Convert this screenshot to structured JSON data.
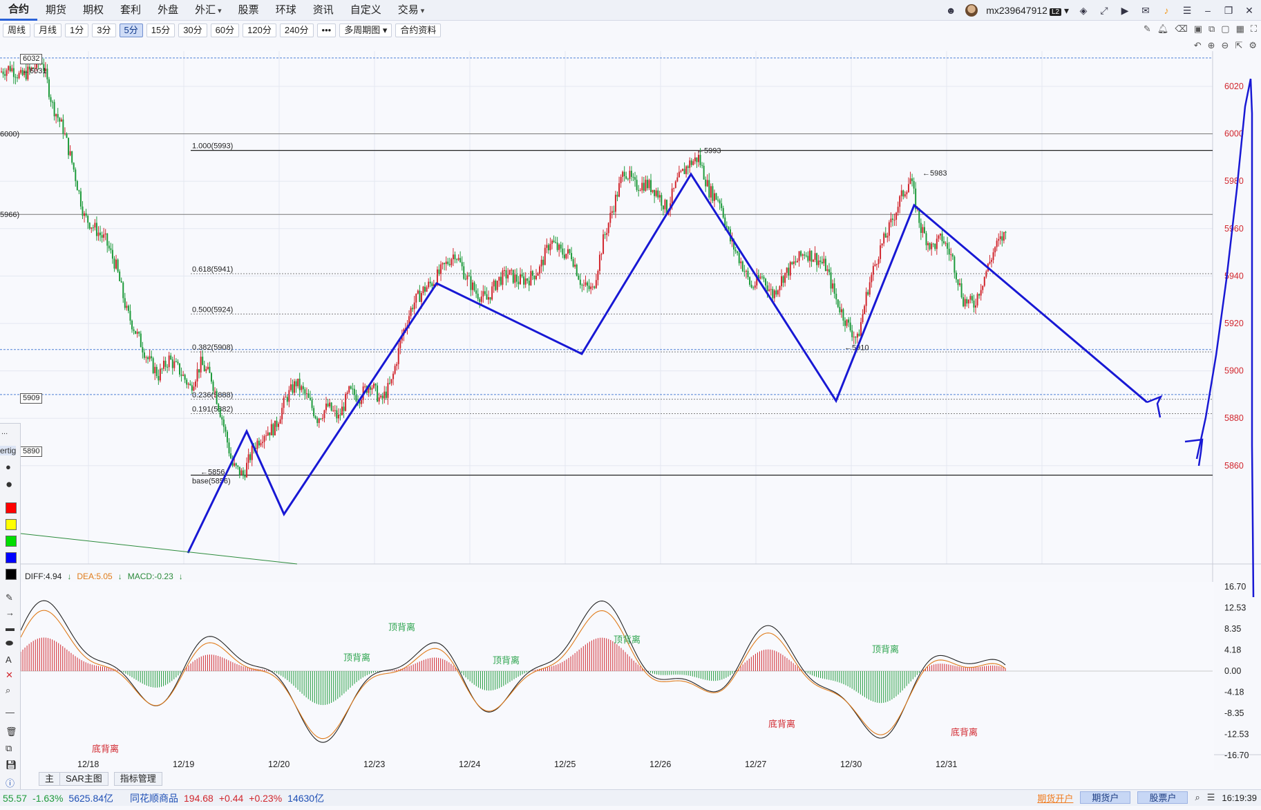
{
  "menu": {
    "items": [
      "合约",
      "期货",
      "期权",
      "套利",
      "外盘",
      "外汇",
      "股票",
      "环球",
      "资讯",
      "自定义",
      "交易"
    ],
    "active": 0,
    "with_caret": [
      5,
      10
    ]
  },
  "user": {
    "name": "mx239647912",
    "level": "L2"
  },
  "toolbar": {
    "periods": [
      "周线",
      "月线",
      "1分",
      "3分",
      "5分",
      "15分",
      "30分",
      "60分",
      "120分",
      "240分",
      "•••",
      "多周期图",
      "合约资料"
    ],
    "active": 4
  },
  "chart_data": {
    "type": "candlestick",
    "x_labels": [
      "12/18",
      "12/19",
      "12/20",
      "12/23",
      "12/24",
      "12/25",
      "12/26",
      "12/27",
      "12/30",
      "12/31"
    ],
    "y_axis": {
      "ticks": [
        6020,
        6000,
        5980,
        5960,
        5940,
        5920,
        5900,
        5880,
        5860
      ],
      "range": [
        5852,
        6034
      ]
    },
    "price_path": [
      [
        0,
        6026
      ],
      [
        1,
        6028
      ],
      [
        2,
        6024
      ],
      [
        3,
        6027
      ],
      [
        4,
        6031
      ],
      [
        5,
        6012
      ],
      [
        6,
        6002
      ],
      [
        7,
        5985
      ],
      [
        8,
        5965
      ],
      [
        9,
        5960
      ],
      [
        10,
        5955
      ],
      [
        11,
        5944
      ],
      [
        12,
        5925
      ],
      [
        13,
        5915
      ],
      [
        14,
        5905
      ],
      [
        15,
        5898
      ],
      [
        16,
        5905
      ],
      [
        17,
        5900
      ],
      [
        18,
        5893
      ],
      [
        19,
        5903
      ],
      [
        20,
        5897
      ],
      [
        21,
        5880
      ],
      [
        22,
        5860
      ],
      [
        23,
        5856
      ],
      [
        24,
        5868
      ],
      [
        25,
        5874
      ],
      [
        26,
        5876
      ],
      [
        27,
        5888
      ],
      [
        28,
        5895
      ],
      [
        29,
        5889
      ],
      [
        30,
        5880
      ],
      [
        31,
        5885
      ],
      [
        32,
        5880
      ],
      [
        33,
        5891
      ],
      [
        34,
        5889
      ],
      [
        35,
        5895
      ],
      [
        36,
        5887
      ],
      [
        37,
        5895
      ],
      [
        38,
        5915
      ],
      [
        39,
        5928
      ],
      [
        40,
        5934
      ],
      [
        41,
        5938
      ],
      [
        42,
        5944
      ],
      [
        43,
        5950
      ],
      [
        44,
        5940
      ],
      [
        45,
        5933
      ],
      [
        46,
        5930
      ],
      [
        47,
        5938
      ],
      [
        48,
        5941
      ],
      [
        49,
        5938
      ],
      [
        50,
        5939
      ],
      [
        51,
        5943
      ],
      [
        52,
        5955
      ],
      [
        53,
        5950
      ],
      [
        54,
        5949
      ],
      [
        55,
        5936
      ],
      [
        56,
        5934
      ],
      [
        57,
        5955
      ],
      [
        58,
        5970
      ],
      [
        59,
        5985
      ],
      [
        60,
        5978
      ],
      [
        61,
        5979
      ],
      [
        62,
        5976
      ],
      [
        63,
        5968
      ],
      [
        64,
        5980
      ],
      [
        65,
        5987
      ],
      [
        66,
        5990
      ],
      [
        67,
        5976
      ],
      [
        68,
        5972
      ],
      [
        69,
        5955
      ],
      [
        70,
        5946
      ],
      [
        71,
        5935
      ],
      [
        72,
        5940
      ],
      [
        73,
        5932
      ],
      [
        74,
        5940
      ],
      [
        75,
        5945
      ],
      [
        76,
        5950
      ],
      [
        77,
        5948
      ],
      [
        78,
        5944
      ],
      [
        79,
        5930
      ],
      [
        80,
        5920
      ],
      [
        81,
        5913
      ],
      [
        82,
        5935
      ],
      [
        83,
        5950
      ],
      [
        84,
        5960
      ],
      [
        85,
        5972
      ],
      [
        86,
        5981
      ],
      [
        87,
        5960
      ],
      [
        88,
        5952
      ],
      [
        89,
        5956
      ],
      [
        90,
        5947
      ],
      [
        91,
        5930
      ],
      [
        92,
        5928
      ],
      [
        93,
        5940
      ],
      [
        94,
        5952
      ],
      [
        95,
        5958
      ]
    ],
    "fib_levels": [
      {
        "label": "1.000(5993)",
        "value": 5993
      },
      {
        "label": "0.618(5941)",
        "value": 5941
      },
      {
        "label": "0.500(5924)",
        "value": 5924
      },
      {
        "label": "0.382(5908)",
        "value": 5908
      },
      {
        "label": "0.236(5888)",
        "value": 5888
      },
      {
        "label": "0.191(5882)",
        "value": 5882
      },
      {
        "label": "base(5856)",
        "value": 5856
      }
    ],
    "price_annotations": [
      {
        "label": "5993"
      },
      {
        "label": "5983"
      },
      {
        "label": "5910"
      },
      {
        "label": "5856"
      },
      {
        "label": "6031"
      }
    ],
    "left_tags": [
      {
        "label": "6032"
      },
      {
        "label": "5909"
      },
      {
        "label": "5890"
      },
      {
        "label": "6000)"
      },
      {
        "label": "5966)"
      }
    ],
    "macd": {
      "diff": "DIFF:4.94",
      "dea": "DEA:5.05",
      "macd": "MACD:-0.23",
      "ticks": [
        "16.70",
        "12.53",
        "8.35",
        "4.18",
        "0.00",
        "-4.18",
        "-8.35",
        "-12.53",
        "-16.70"
      ],
      "tick_values": [
        16.7,
        12.53,
        8.35,
        4.18,
        0.0,
        -4.18,
        -8.35,
        -12.53,
        -16.7
      ],
      "signals": [
        {
          "text": "顶背离",
          "kind": "top"
        },
        {
          "text": "顶背离",
          "kind": "top"
        },
        {
          "text": "顶背离",
          "kind": "top"
        },
        {
          "text": "顶背离",
          "kind": "top"
        },
        {
          "text": "顶背离",
          "kind": "top"
        },
        {
          "text": "底背离",
          "kind": "bottom"
        },
        {
          "text": "底背离",
          "kind": "bottom"
        },
        {
          "text": "底背离",
          "kind": "bottom"
        }
      ]
    }
  },
  "toolbox": {
    "mode_label": "ertig",
    "dots": "..."
  },
  "bottom_tabs": [
    "主",
    "SAR主图",
    "指标管理"
  ],
  "status": {
    "item1_price": "55.57",
    "item1_change": "-1.63%",
    "item1_volume": "5625.84亿",
    "item2_name": "同花顺商品",
    "item2_price": "194.68",
    "item2_change": "+0.44",
    "item2_pct": "+0.23%",
    "item2_volume": "14630亿",
    "open_link": "期货开户",
    "btn1": "期货户",
    "btn2": "股票户",
    "clock": "16:19:39"
  },
  "colors": {
    "up": "#d1262d",
    "down": "#1d9a3a",
    "annotation": "#1818d4",
    "accent": "#2a62d8"
  }
}
